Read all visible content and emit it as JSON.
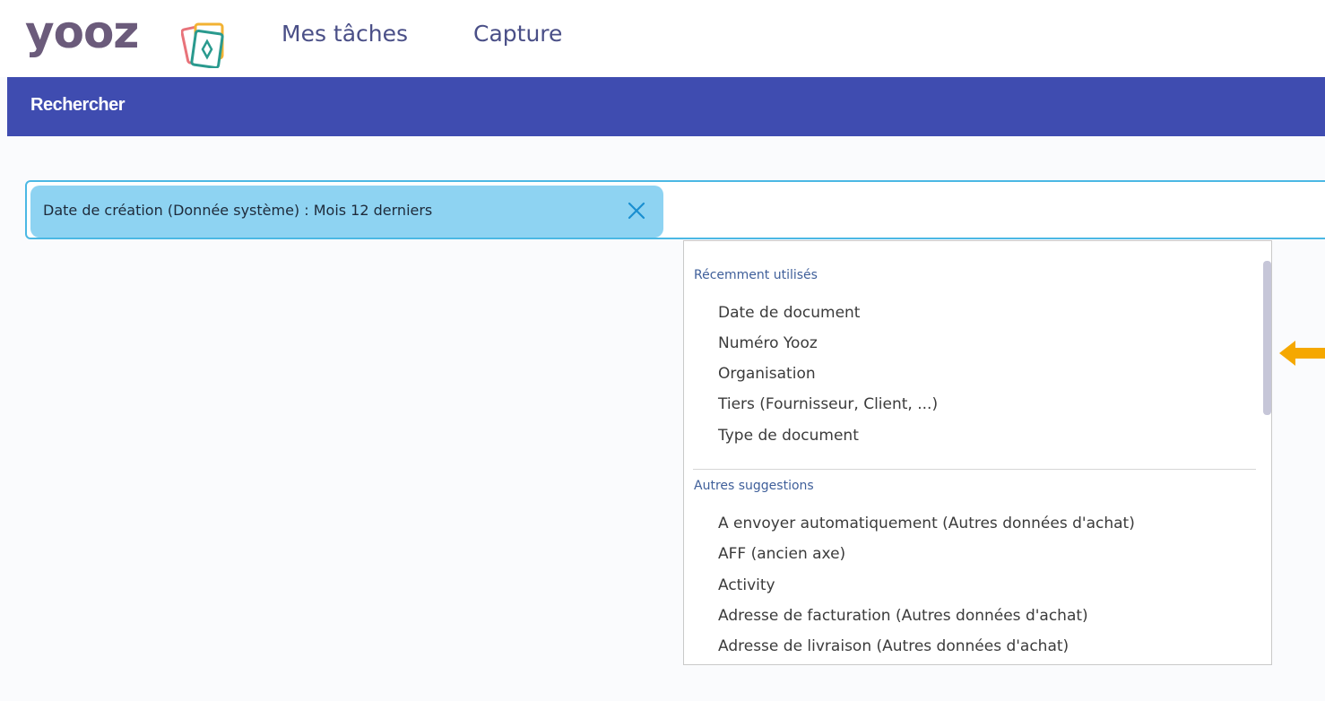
{
  "header": {
    "logo_text": "yooz",
    "nav": [
      {
        "label": "Mes tâches"
      },
      {
        "label": "Capture"
      }
    ]
  },
  "page": {
    "title": "Rechercher"
  },
  "search": {
    "chip_label": "Date de création (Donnée système) : Mois 12 derniers"
  },
  "dropdown": {
    "sections": [
      {
        "title": "Récemment utilisés",
        "items": [
          "Date de document",
          "Numéro Yooz",
          "Organisation",
          "Tiers (Fournisseur, Client, ...)",
          "Type de document"
        ]
      },
      {
        "title": "Autres suggestions",
        "items": [
          "A envoyer automatiquement (Autres données d'achat)",
          "AFF (ancien axe)",
          "Activity",
          "Adresse de facturation (Autres données d'achat)",
          "Adresse de livraison (Autres données d'achat)"
        ]
      }
    ]
  },
  "icons": {
    "chip_close": "close-icon",
    "logo_mark": "yooz-cards-logo-icon",
    "annotation": "arrow-left-icon"
  },
  "colors": {
    "brand_bar": "#3f4cb0",
    "chip_bg": "#8ed3f2",
    "search_border": "#4bb8e4",
    "section_title": "#3f5f9a",
    "annotation_arrow": "#f5a800"
  }
}
